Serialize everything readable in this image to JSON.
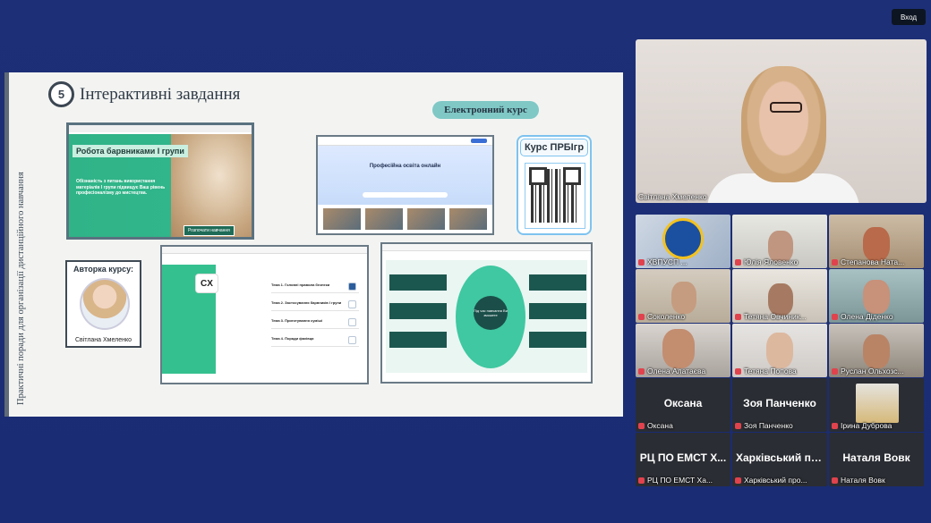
{
  "top_bar": {
    "login_label": "Вход"
  },
  "slide": {
    "number": "5",
    "title": "Інтерактивні завдання",
    "vertical_text": "Практичні поради для організації дистанційного навчання",
    "ecourse_label": "Електронний курс",
    "course_label": "Курс ПРБІгр",
    "author_title": "Авторка курсу:",
    "author_name": "Світлана Хмеленко",
    "card1": {
      "heading": "Робота барвниками І групи",
      "text": "Обізнаність з питань використання матеріалів І групи підвищує Ваш рівень професіоналізму до мистецтва.",
      "button": "Розпочати навчання"
    },
    "card2": {
      "heading": "Професійна освіта онлайн"
    },
    "card3": {
      "topics": [
        "Тема 1. Головні правила безпеки",
        "Тема 2. Застосування барвників І групи",
        "Тема 3. Приготування суміші",
        "Тема 4. Поради фахівця"
      ]
    },
    "card4": {
      "center": "Під час навчання Ви зможете"
    }
  },
  "speaker": {
    "name": "Світлана Хмеленко"
  },
  "participants": [
    {
      "name": "ХВПУСП ..."
    },
    {
      "name": "Юлія Яловенко"
    },
    {
      "name": "Степанова Ната..."
    },
    {
      "name": "Соколенко"
    },
    {
      "name": "Тетяна Овчиник..."
    },
    {
      "name": "Олена Діденко"
    },
    {
      "name": "Олена Алатаєва"
    },
    {
      "name": "Тетяна  Попова"
    },
    {
      "name": "Руслан Ольхозс..."
    },
    {
      "name": "Оксана",
      "big": "Оксана"
    },
    {
      "name": "Зоя Панченко",
      "big": "Зоя Панченко"
    },
    {
      "name": "Ірина Дуброва"
    },
    {
      "name": "РЦ ПО ЕМСТ Ха...",
      "big": "РЦ ПО ЕМСТ Х..."
    },
    {
      "name": "Харківський про...",
      "big": "Харківський пр..."
    },
    {
      "name": "Наталя Вовк",
      "big": "Наталя Вовк"
    }
  ]
}
